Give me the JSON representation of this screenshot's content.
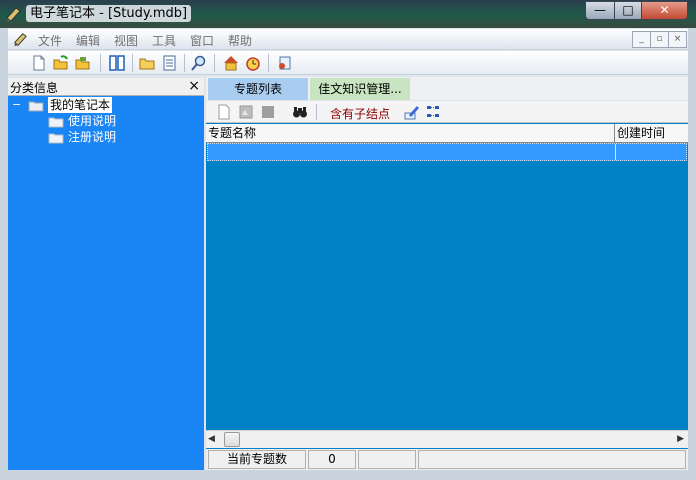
{
  "window": {
    "title": "电子笔记本 - [Study.mdb]"
  },
  "caption_buttons": {
    "minimize": "—",
    "maximize": "□",
    "close": "✕"
  },
  "menu": {
    "items": [
      "文件",
      "编辑",
      "视图",
      "工具",
      "窗口",
      "帮助"
    ],
    "mdi_buttons": [
      "_",
      "▫",
      "×"
    ]
  },
  "toolbar": {
    "icons": [
      "new-document-icon",
      "open-icon",
      "open-folder-icon",
      "split-view-icon",
      "folder-icon",
      "list-icon",
      "search-icon",
      "home-icon",
      "alarm-clock-icon",
      "info-icon"
    ]
  },
  "left_panel": {
    "title": "分类信息",
    "close": "×",
    "tree": {
      "root": "我的笔记本",
      "expander": "−",
      "children": [
        "使用说明",
        "注册说明"
      ]
    }
  },
  "tabs": [
    "专题列表",
    "佳文知识管理..."
  ],
  "subtoolbar": {
    "filter_label": "含有子结点",
    "icons": [
      "blank-page-icon",
      "gray-page-icon",
      "gray-square-icon",
      "binoculars-icon",
      "edit-pen-icon",
      "tree-structure-icon"
    ]
  },
  "grid": {
    "columns": [
      "专题名称",
      "创建时间"
    ]
  },
  "status": {
    "label": "当前专题数",
    "count": "0"
  },
  "colors": {
    "tree_bg": "#1a85f5",
    "grid_bg": "#0081c6",
    "row_selected": "#3399ff",
    "filter_text": "#8b0000"
  }
}
